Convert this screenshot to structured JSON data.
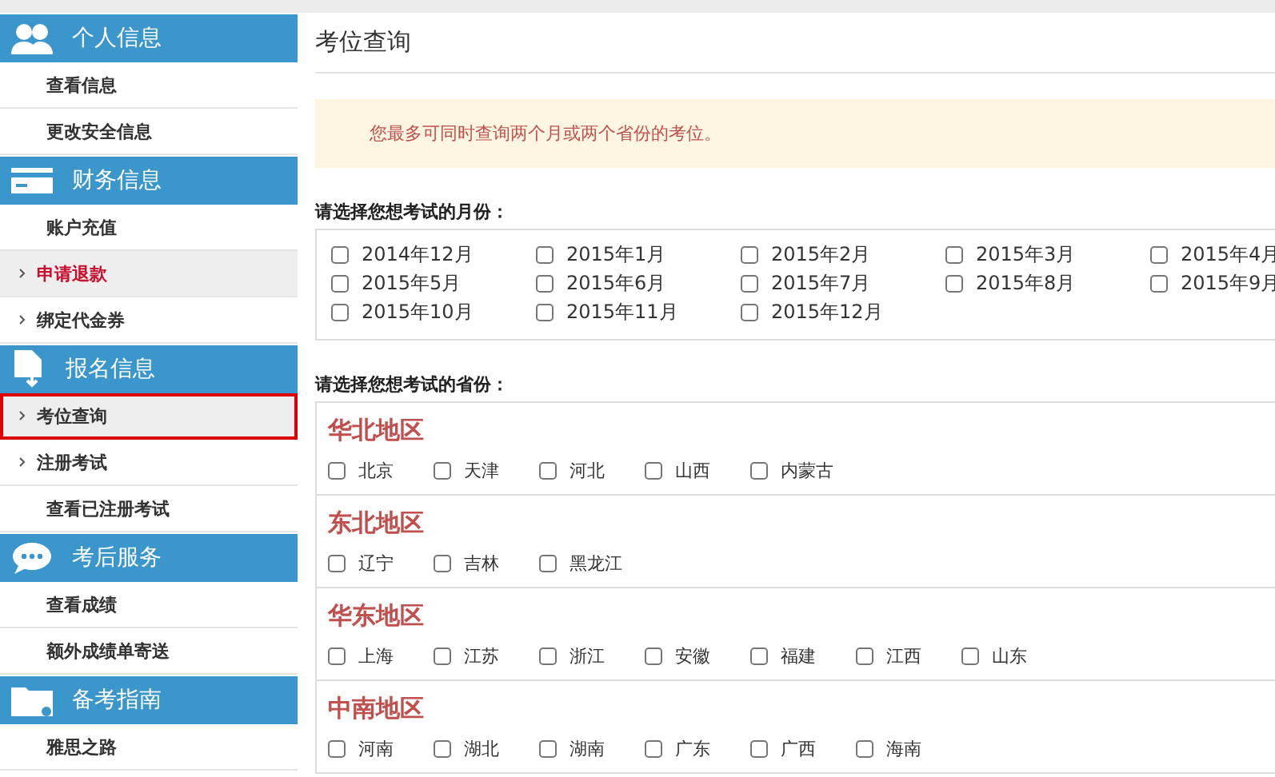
{
  "sidebar": {
    "sections": [
      {
        "title": "个人信息",
        "items": [
          {
            "label": "查看信息",
            "arrow": false,
            "highlighted": false,
            "selected": false
          },
          {
            "label": "更改安全信息",
            "arrow": false,
            "highlighted": false,
            "selected": false
          }
        ]
      },
      {
        "title": "财务信息",
        "items": [
          {
            "label": "账户充值",
            "arrow": false,
            "highlighted": false,
            "selected": false
          },
          {
            "label": "申请退款",
            "arrow": true,
            "highlighted": true,
            "selected": false
          },
          {
            "label": "绑定代金券",
            "arrow": true,
            "highlighted": false,
            "selected": false
          }
        ]
      },
      {
        "title": "报名信息",
        "items": [
          {
            "label": "考位查询",
            "arrow": true,
            "highlighted": false,
            "selected": true
          },
          {
            "label": "注册考试",
            "arrow": true,
            "highlighted": false,
            "selected": false
          },
          {
            "label": "查看已注册考试",
            "arrow": false,
            "highlighted": false,
            "selected": false
          }
        ]
      },
      {
        "title": "考后服务",
        "items": [
          {
            "label": "查看成绩",
            "arrow": false,
            "highlighted": false,
            "selected": false
          },
          {
            "label": "额外成绩单寄送",
            "arrow": false,
            "highlighted": false,
            "selected": false
          }
        ]
      },
      {
        "title": "备考指南",
        "items": [
          {
            "label": "雅思之路",
            "arrow": false,
            "highlighted": false,
            "selected": false
          }
        ]
      }
    ]
  },
  "page": {
    "title": "考位查询",
    "notice": "您最多可同时查询两个月或两个省份的考位。",
    "months": {
      "label": "请选择您想考试的月份：",
      "options": [
        {
          "label": "2014年12月",
          "checked": false
        },
        {
          "label": "2015年1月",
          "checked": false
        },
        {
          "label": "2015年2月",
          "checked": false
        },
        {
          "label": "2015年3月",
          "checked": false
        },
        {
          "label": "2015年4月",
          "checked": false
        },
        {
          "label": "2015年5月",
          "checked": false
        },
        {
          "label": "2015年6月",
          "checked": false
        },
        {
          "label": "2015年7月",
          "checked": false
        },
        {
          "label": "2015年8月",
          "checked": false
        },
        {
          "label": "2015年9月",
          "checked": false
        },
        {
          "label": "2015年10月",
          "checked": false
        },
        {
          "label": "2015年11月",
          "checked": false
        },
        {
          "label": "2015年12月",
          "checked": false
        }
      ]
    },
    "provinces": {
      "label": "请选择您想考试的省份：",
      "regions": [
        {
          "name": "华北地区",
          "options": [
            {
              "label": "北京",
              "checked": false
            },
            {
              "label": "天津",
              "checked": false
            },
            {
              "label": "河北",
              "checked": false
            },
            {
              "label": "山西",
              "checked": false
            },
            {
              "label": "内蒙古",
              "checked": false
            }
          ]
        },
        {
          "name": "东北地区",
          "options": [
            {
              "label": "辽宁",
              "checked": false
            },
            {
              "label": "吉林",
              "checked": false
            },
            {
              "label": "黑龙江",
              "checked": false
            }
          ]
        },
        {
          "name": "华东地区",
          "options": [
            {
              "label": "上海",
              "checked": false
            },
            {
              "label": "江苏",
              "checked": false
            },
            {
              "label": "浙江",
              "checked": false
            },
            {
              "label": "安徽",
              "checked": false
            },
            {
              "label": "福建",
              "checked": false
            },
            {
              "label": "江西",
              "checked": false
            },
            {
              "label": "山东",
              "checked": false
            }
          ]
        },
        {
          "name": "中南地区",
          "options": [
            {
              "label": "河南",
              "checked": false
            },
            {
              "label": "湖北",
              "checked": false
            },
            {
              "label": "湖南",
              "checked": false
            },
            {
              "label": "广东",
              "checked": false
            },
            {
              "label": "广西",
              "checked": false
            },
            {
              "label": "海南",
              "checked": false
            }
          ]
        }
      ]
    }
  }
}
